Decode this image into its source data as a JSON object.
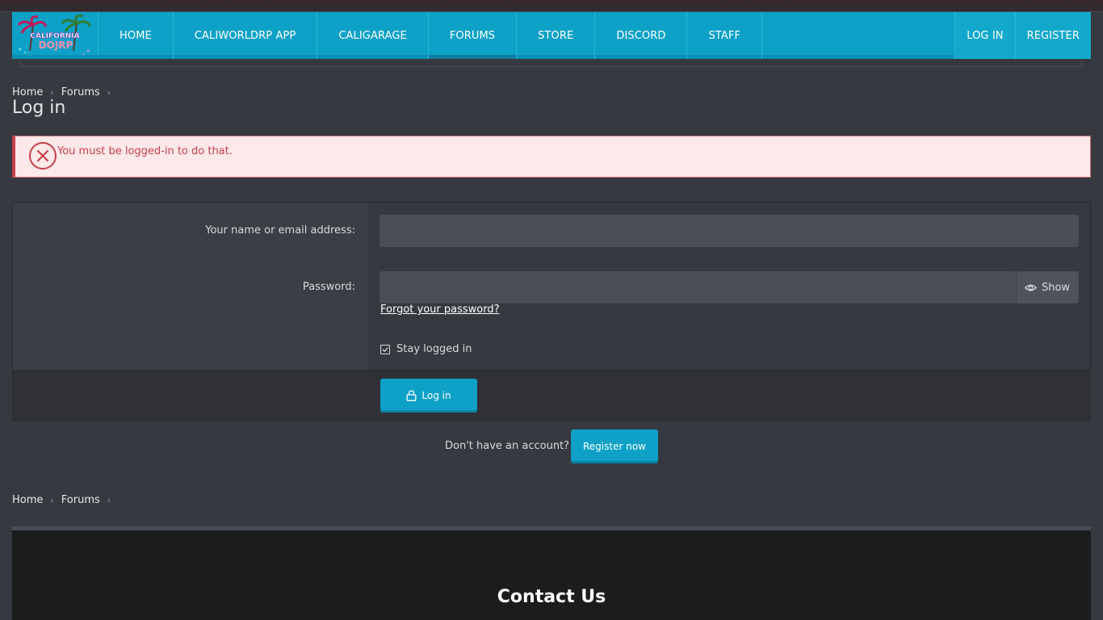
{
  "nav": {
    "logo_line1": "CALIFORNIA",
    "logo_line2": "DOJRP",
    "items": [
      "HOME",
      "CALIWORLDRP APP",
      "CALIGARAGE",
      "FORUMS",
      "STORE",
      "DISCORD",
      "STAFF"
    ],
    "active": "FORUMS",
    "login": "LOG IN",
    "register": "REGISTER"
  },
  "breadcrumb": {
    "home": "Home",
    "forums": "Forums"
  },
  "page": {
    "title": "Log in"
  },
  "error": {
    "message": "You must be logged-in to do that."
  },
  "form": {
    "name_label": "Your name or email address:",
    "name_value": "",
    "password_label": "Password:",
    "password_value": "",
    "show_label": "Show",
    "forgot_label": "Forgot your password?",
    "stay_logged_in": "Stay logged in",
    "stay_checked": true,
    "login_button": "Log in"
  },
  "register": {
    "prompt": "Don't have an account?",
    "button": "Register now"
  },
  "footer": {
    "title": "Contact Us"
  },
  "colors": {
    "accent": "#0da1c7",
    "error": "#c7404b",
    "background": "#363940"
  },
  "icons": [
    "close-circle-icon",
    "eye-icon",
    "lock-icon",
    "chevron-right-icon",
    "checkbox-icon"
  ]
}
